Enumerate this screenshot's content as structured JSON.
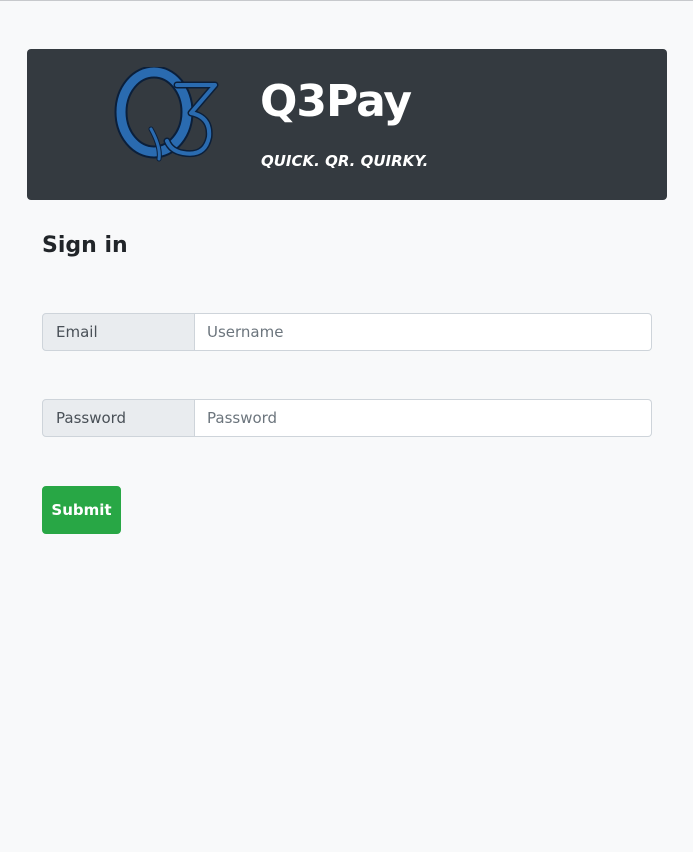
{
  "header": {
    "logo_alt": "Q3",
    "title": "Q3Pay",
    "tagline": "QUICK. QR. QUIRKY."
  },
  "form": {
    "heading": "Sign in",
    "email": {
      "label": "Email",
      "placeholder": "Username",
      "value": ""
    },
    "password": {
      "label": "Password",
      "placeholder": "Password",
      "value": ""
    },
    "submit_label": "Submit"
  },
  "colors": {
    "banner_bg": "#343a40",
    "logo_blue": "#2a6bb0",
    "submit_green": "#28a745",
    "page_bg": "#f8f9fa"
  }
}
